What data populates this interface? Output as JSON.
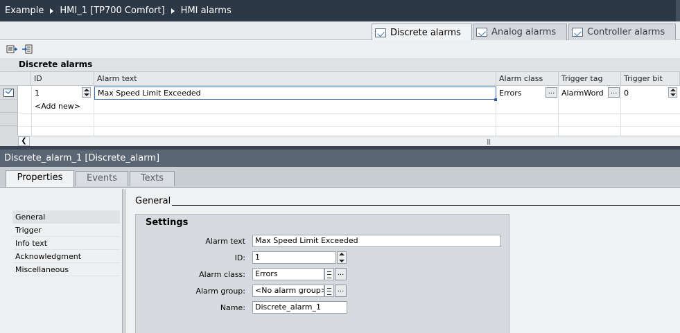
{
  "breadcrumb": [
    "Example",
    "HMI_1 [TP700 Comfort]",
    "HMI alarms"
  ],
  "alarm_tabs": [
    {
      "label": "Discrete alarms",
      "active": true
    },
    {
      "label": "Analog alarms",
      "active": false
    },
    {
      "label": "Controller alarms",
      "active": false
    }
  ],
  "toolbar": {
    "icons": [
      "insert-row-icon",
      "append-row-icon"
    ]
  },
  "grid": {
    "title": "Discrete alarms",
    "columns": [
      "ID",
      "Alarm text",
      "Alarm class",
      "Trigger tag",
      "Trigger bit"
    ],
    "rows": [
      {
        "id": "1",
        "alarm_text": "Max Speed Limit Exceeded",
        "alarm_class": "Errors",
        "trigger_tag": "AlarmWord",
        "trigger_bit": "0"
      }
    ],
    "add_new": "<Add new>"
  },
  "inspector": {
    "title": "Discrete_alarm_1 [Discrete_alarm]",
    "tabs": [
      "Properties",
      "Events",
      "Texts"
    ],
    "nav": [
      "General",
      "Trigger",
      "Info text",
      "Acknowledgment",
      "Miscellaneous"
    ],
    "section": "General",
    "settings": {
      "heading": "Settings",
      "alarm_text_label": "Alarm text",
      "alarm_text": "Max Speed Limit Exceeded",
      "id_label": "ID:",
      "id": "1",
      "alarm_class_label": "Alarm class:",
      "alarm_class": "Errors",
      "alarm_group_label": "Alarm group:",
      "alarm_group": "<No alarm group>",
      "name_label": "Name:",
      "name": "Discrete_alarm_1"
    }
  },
  "colors": {
    "title_bar": "#2d3847",
    "inspector_title": "#5b6674",
    "splitter": "#3a4452"
  }
}
